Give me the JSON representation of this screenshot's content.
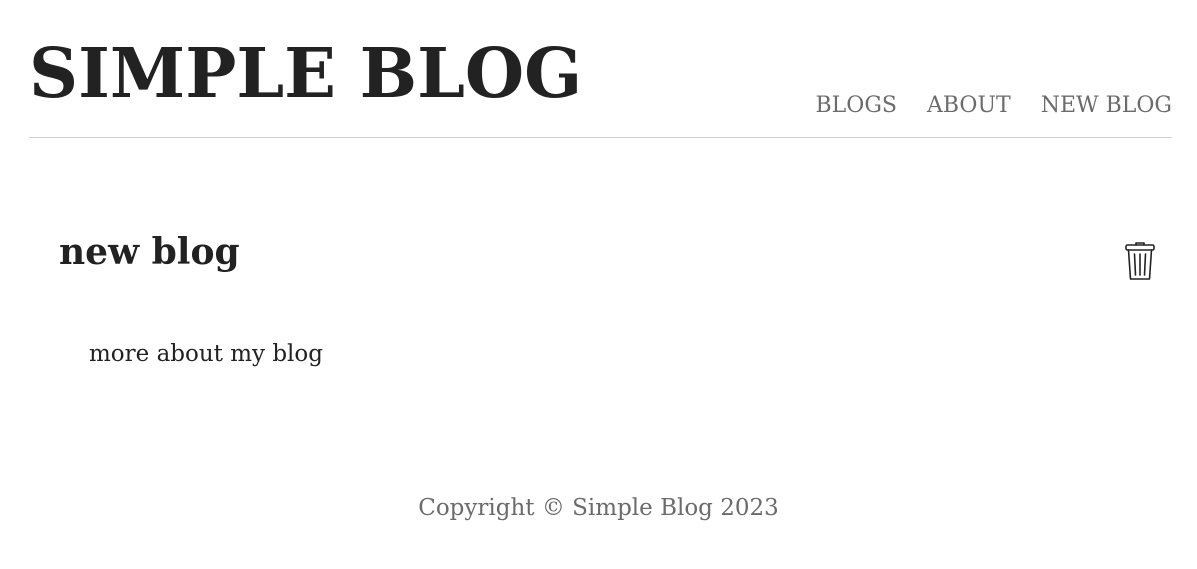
{
  "header": {
    "site_title": "SIMPLE BLOG",
    "nav": [
      {
        "label": "BLOGS"
      },
      {
        "label": "ABOUT"
      },
      {
        "label": "NEW BLOG"
      }
    ]
  },
  "post": {
    "title": "new blog",
    "body": "more about my blog",
    "delete_icon": "trash-icon"
  },
  "footer": {
    "copyright": "Copyright © Simple Blog 2023"
  },
  "colors": {
    "text": "#222222",
    "muted": "#6b6b6b",
    "divider": "#c6d6d8",
    "background": "#ffffff"
  }
}
